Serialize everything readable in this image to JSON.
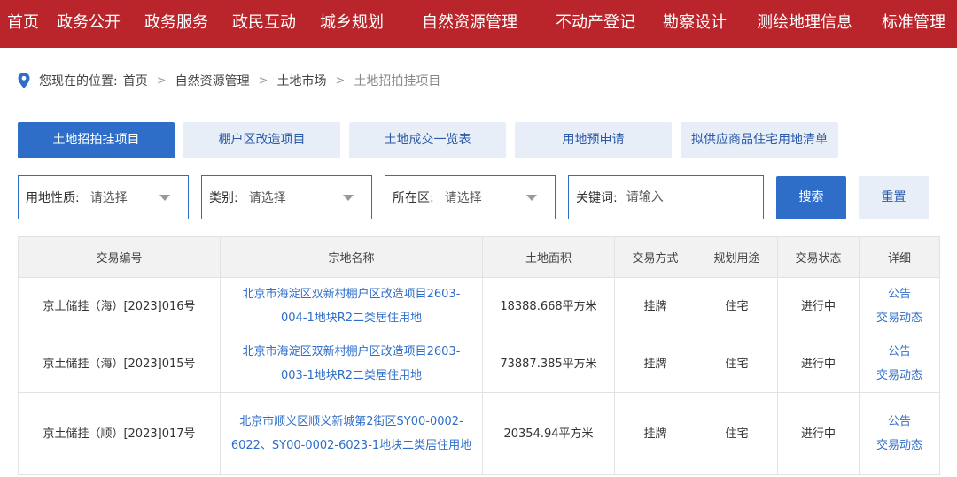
{
  "nav": {
    "items": [
      "首页",
      "政务公开",
      "政务服务",
      "政民互动",
      "城乡规划",
      "自然资源管理",
      "不动产登记",
      "勘察设计",
      "测绘地理信息",
      "标准管理"
    ]
  },
  "breadcrumb": {
    "prefix": "您现在的位置:",
    "items": [
      "首页",
      "自然资源管理",
      "土地市场",
      "土地招拍挂项目"
    ],
    "separator": ">"
  },
  "tabs": [
    "土地招拍挂项目",
    "棚户区改造项目",
    "土地成交一览表",
    "用地预申请",
    "拟供应商品住宅用地清单"
  ],
  "active_tab": "土地招拍挂项目",
  "filters": {
    "land_use": {
      "label": "用地性质:",
      "value": "请选择"
    },
    "category": {
      "label": "类别:",
      "value": "请选择"
    },
    "district": {
      "label": "所在区:",
      "value": "请选择"
    },
    "keyword": {
      "label": "关键词:",
      "placeholder": "请输入",
      "value": ""
    }
  },
  "buttons": {
    "search": "搜索",
    "reset": "重置"
  },
  "table": {
    "headers": [
      "交易编号",
      "宗地名称",
      "土地面积",
      "交易方式",
      "规划用途",
      "交易状态",
      "详细"
    ],
    "rows": [
      {
        "id": "京土储挂（海）[2023]016号",
        "name": "北京市海淀区双新村棚户区改造项目2603-004-1地块R2二类居住用地",
        "area": "18388.668平方米",
        "method": "挂牌",
        "use": "住宅",
        "status": "进行中",
        "links": [
          "公告",
          "交易动态"
        ]
      },
      {
        "id": "京土储挂（海）[2023]015号",
        "name": "北京市海淀区双新村棚户区改造项目2603-003-1地块R2二类居住用地",
        "area": "73887.385平方米",
        "method": "挂牌",
        "use": "住宅",
        "status": "进行中",
        "links": [
          "公告",
          "交易动态"
        ]
      },
      {
        "id": "京土储挂（顺）[2023]017号",
        "name": "北京市顺义区顺义新城第2街区SY00-0002-6022、SY00-0002-6023-1地块二类居住用地",
        "area": "20354.94平方米",
        "method": "挂牌",
        "use": "住宅",
        "status": "进行中",
        "links": [
          "公告",
          "交易动态"
        ]
      }
    ]
  },
  "colors": {
    "nav_bg": "#b9252b",
    "primary": "#2e6ec8",
    "tab_bg": "#e8eef8",
    "link": "#2e6ec8"
  }
}
